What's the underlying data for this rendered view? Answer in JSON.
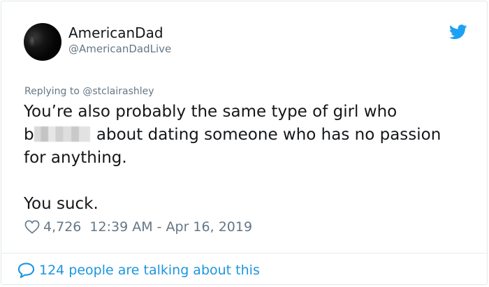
{
  "author": {
    "display_name": "AmericanDad",
    "handle": "@AmericanDadLive"
  },
  "reply": {
    "prefix": "Replying to",
    "mention": "@stclairashley"
  },
  "tweet": {
    "line1": "You’re also probably the same type of girl who",
    "line2_start": "b",
    "line2_end": " about dating someone who has no passion",
    "line3": "for anything.",
    "line4": "You suck."
  },
  "meta": {
    "likes": "4,726",
    "timestamp": "12:39 AM - Apr 16, 2019"
  },
  "footer": {
    "talking": "124 people are talking about this"
  },
  "colors": {
    "twitter_blue": "#1da1f2",
    "link_blue": "#1b95e0",
    "secondary_text": "#657786",
    "primary_text": "#14171a"
  },
  "icons": {
    "bird": "twitter-bird-icon",
    "heart": "heart-outline-icon",
    "bubble": "speech-bubble-icon"
  }
}
